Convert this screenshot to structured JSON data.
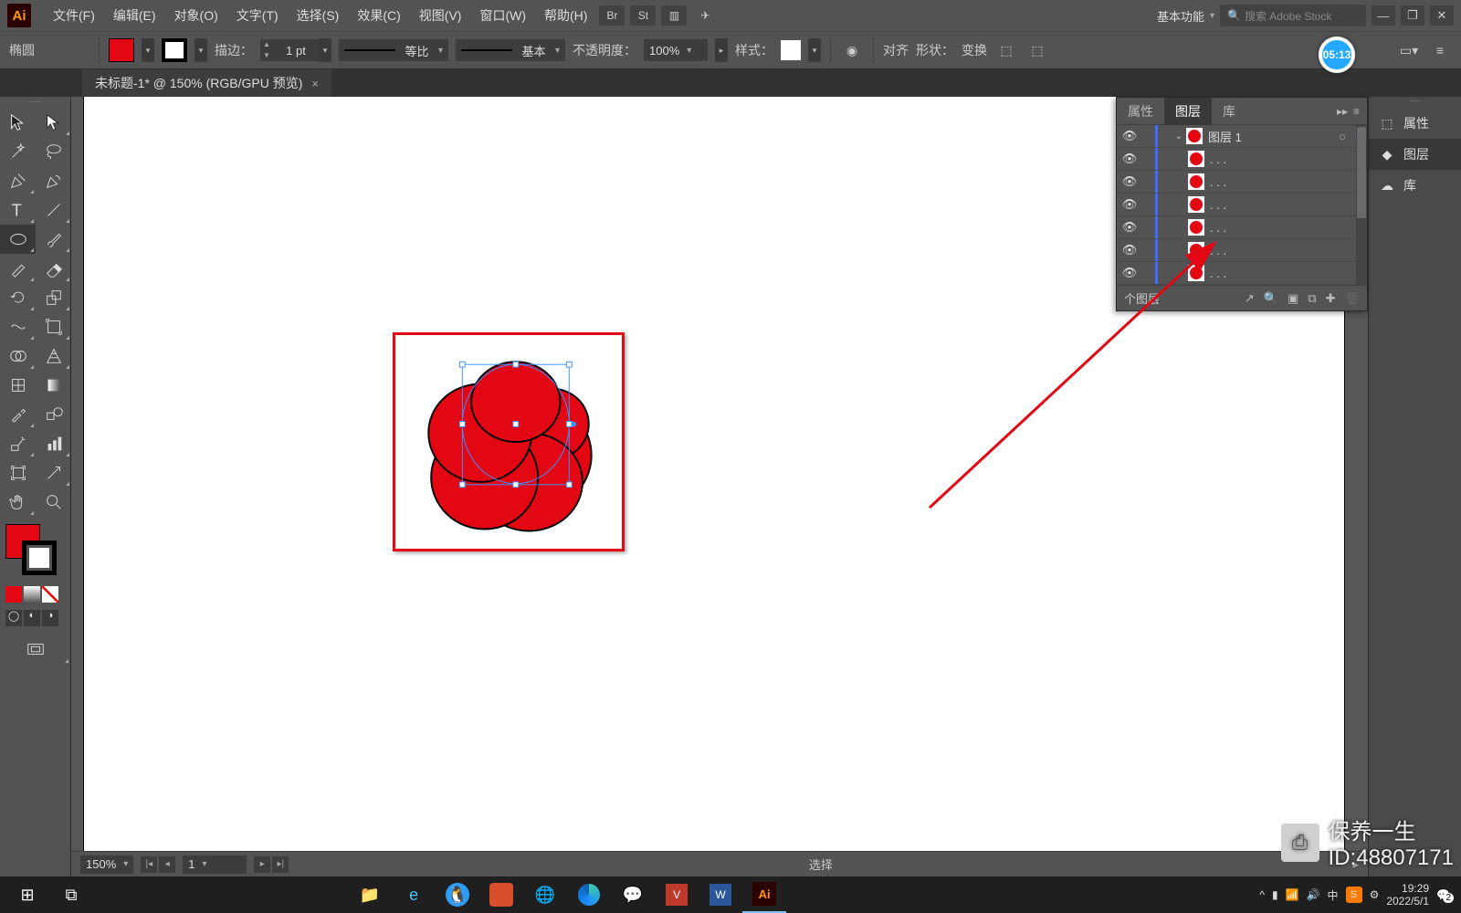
{
  "app": {
    "logo": "Ai"
  },
  "menu": {
    "items": [
      "文件(F)",
      "编辑(E)",
      "对象(O)",
      "文字(T)",
      "选择(S)",
      "效果(C)",
      "视图(V)",
      "窗口(W)",
      "帮助(H)"
    ],
    "workspace": "基本功能",
    "search_placeholder": "搜索 Adobe Stock",
    "br_icon": "Br",
    "st_icon": "St"
  },
  "timer": "05:13",
  "ctrl": {
    "toolname": "椭圆",
    "stroke_label": "描边：",
    "stroke_weight": "1 pt",
    "profile_label": "等比",
    "brush_label": "基本",
    "opacity_label": "不透明度：",
    "opacity_value": "100%",
    "style_label": "样式：",
    "align_label": "对齐",
    "shape_label": "形状：",
    "transform_label": "变换"
  },
  "doc": {
    "tab_title": "未标题-1* @ 150% (RGB/GPU 预览)"
  },
  "status": {
    "zoom": "150%",
    "page": "1",
    "mode": "选择"
  },
  "rpanel": {
    "items": [
      {
        "label": "属性",
        "icon": "⬚"
      },
      {
        "label": "图层",
        "icon": "◆"
      },
      {
        "label": "库",
        "icon": "☁"
      }
    ]
  },
  "layers": {
    "tabs": [
      "属性",
      "图层",
      "库"
    ],
    "active_tab": 1,
    "layer_name": "图层 1",
    "sublayer_label": ". . .",
    "sublayer_count": 6,
    "footer_label": "个图层"
  },
  "taskbar": {
    "time": "19:29",
    "date": "2022/5/1",
    "ime": "中",
    "notif": "2"
  },
  "watermark": {
    "line1": "保养一生",
    "line2": "ID:48807171"
  },
  "colors": {
    "accent": "#e30613",
    "ui_dark": "#535353"
  }
}
